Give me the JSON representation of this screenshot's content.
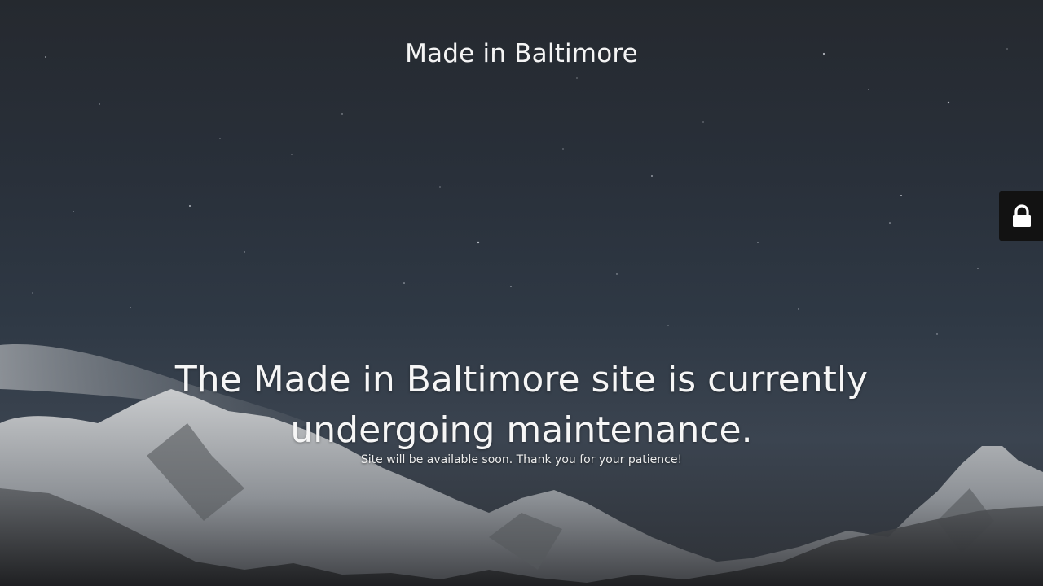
{
  "site": {
    "title": "Made in Baltimore"
  },
  "maintenance": {
    "headline": "The Made in Baltimore site is currently undergoing maintenance.",
    "message": "Site will be available soon. Thank you for your patience!"
  },
  "admin_login": {
    "icon": "lock-icon"
  },
  "colors": {
    "text": "#f4f4f4",
    "login_tab_background": "#121212",
    "sky_top": "#25292f",
    "sky_bottom": "#3b4450"
  }
}
